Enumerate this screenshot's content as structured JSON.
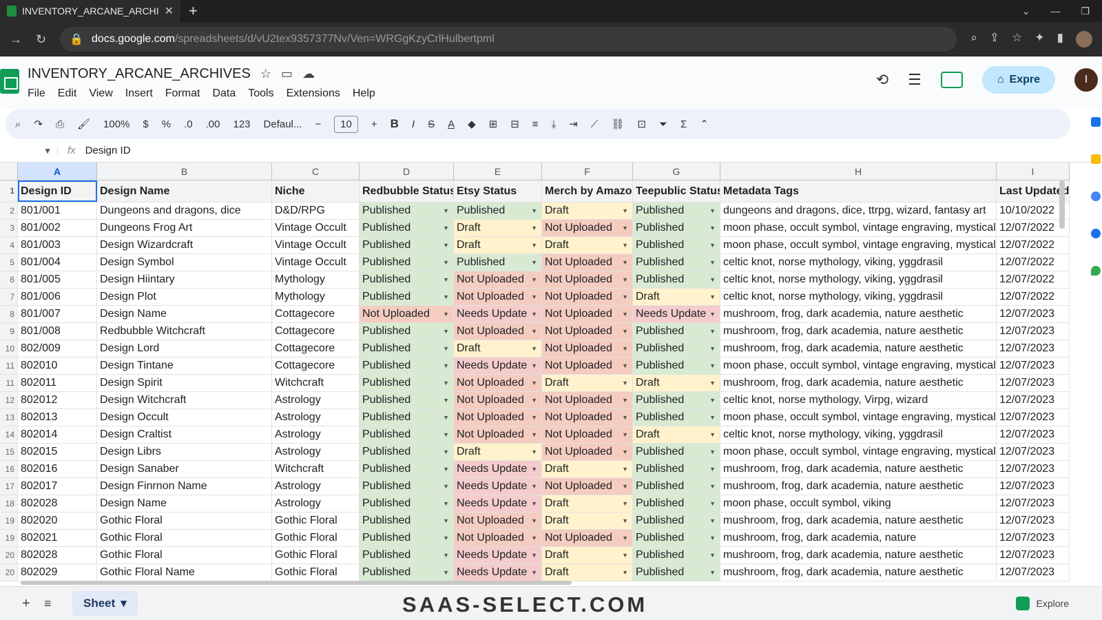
{
  "browser": {
    "tab_title": "INVENTORY_ARCANE_ARCHIVES",
    "url_host": "docs.google.com",
    "url_path": "/spreadsheets/d/vU2tex9357377Nv/Ven=WRGgKzyCrlHulbertpml"
  },
  "app": {
    "doc_title": "INVENTORY_ARCANE_ARCHIVES",
    "menus": [
      "File",
      "Edit",
      "View",
      "Insert",
      "Format",
      "Data",
      "Tools",
      "Extensions",
      "Help"
    ],
    "share_label": "Expre",
    "avatar_letter": "I"
  },
  "toolbar": {
    "zoom": "100%",
    "currency": "$",
    "percent": "%",
    "dec_decrease": ".0",
    "dec_increase": ".00",
    "number_format": "123",
    "font": "Defaul...",
    "font_size": "10",
    "bold": "B",
    "italic": "I",
    "strike": "S",
    "text_color": "A"
  },
  "formula_bar": {
    "value": "Design ID"
  },
  "columns": [
    "A",
    "B",
    "C",
    "D",
    "E",
    "F",
    "G",
    "H",
    "I"
  ],
  "header_row": {
    "row_num": "1",
    "cells": [
      "Design ID",
      "Design Name",
      "Niche",
      "Redbubble Status",
      "Etsy Status",
      "Merch by Amazo",
      "Teepublic Status",
      "Metadata Tags",
      "Last Updated"
    ]
  },
  "rows": [
    {
      "n": "2",
      "id": "801/001",
      "name": "Dungeons and dragons, dice",
      "niche": "D&D/RPG",
      "rb": "Published",
      "etsy": "Published",
      "merch": "Draft",
      "tee": "Published",
      "tags": "dungeons and dragons, dice, ttrpg, wizard, fantasy art",
      "date": "10/10/2022"
    },
    {
      "n": "3",
      "id": "801/002",
      "name": "Dungeons Frog Art",
      "niche": "Vintage Occult",
      "rb": "Published",
      "etsy": "Draft",
      "merch": "Not Uploaded",
      "tee": "Published",
      "tags": "moon phase, occult symbol, vintage engraving, mystical",
      "date": "12/07/2022"
    },
    {
      "n": "4",
      "id": "801/003",
      "name": "Design Wizardcraft",
      "niche": "Vintage Occult",
      "rb": "Published",
      "etsy": "Draft",
      "merch": "Draft",
      "tee": "Published",
      "tags": "moon phase, occult symbol, vintage engraving, mystical",
      "date": "12/07/2022"
    },
    {
      "n": "5",
      "id": "801/004",
      "name": "Design Symbol",
      "niche": "Vintage Occult",
      "rb": "Published",
      "etsy": "Published",
      "merch": "Not Uploaded",
      "tee": "Published",
      "tags": "celtic knot, norse mythology, viking, yggdrasil",
      "date": "12/07/2022"
    },
    {
      "n": "6",
      "id": "801/005",
      "name": "Design Hiintary",
      "niche": "Mythology",
      "rb": "Published",
      "etsy": "Not Uploaded",
      "merch": "Not Uploaded",
      "tee": "Published",
      "tags": "celtic knot, norse mythology, viking, yggdrasil",
      "date": "12/07/2022"
    },
    {
      "n": "7",
      "id": "801/006",
      "name": "Design Plot",
      "niche": "Mythology",
      "rb": "Published",
      "etsy": "Not Uploaded",
      "merch": "Not Uploaded",
      "tee": "Draft",
      "tags": "celtic knot, norse mythology, viking, yggdrasil",
      "date": "12/07/2022"
    },
    {
      "n": "8",
      "id": "801/007",
      "name": "Design Name",
      "niche": "Cottagecore",
      "rb": "Not Uploaded",
      "etsy": "Needs Update",
      "merch": "Not Uploaded",
      "tee": "Needs Update",
      "tags": "mushroom, frog, dark academia, nature aesthetic",
      "date": "12/07/2023"
    },
    {
      "n": "9",
      "id": "801/008",
      "name": "Redbubble Witchcraft",
      "niche": "Cottagecore",
      "rb": "Published",
      "etsy": "Not Uploaded",
      "merch": "Not Uploaded",
      "tee": "Published",
      "tags": "mushroom, frog, dark academia, nature aesthetic",
      "date": "12/07/2023"
    },
    {
      "n": "10",
      "id": "802/009",
      "name": "Design Lord",
      "niche": "Cottagecore",
      "rb": "Published",
      "etsy": "Draft",
      "merch": "Not Uploaded",
      "tee": "Published",
      "tags": "mushroom, frog, dark academia, nature aesthetic",
      "date": "12/07/2023"
    },
    {
      "n": "11",
      "id": "802010",
      "name": "Design Tintane",
      "niche": "Cottagecore",
      "rb": "Published",
      "etsy": "Needs Update",
      "merch": "Not Uploaded",
      "tee": "Published",
      "tags": "moon phase, occult symbol, vintage engraving, mystical",
      "date": "12/07/2023"
    },
    {
      "n": "11",
      "id": "802011",
      "name": "Design Spirit",
      "niche": "Witchcraft",
      "rb": "Published",
      "etsy": "Not Uploaded",
      "merch": "Draft",
      "tee": "Draft",
      "tags": "mushroom, frog, dark academia, nature aesthetic",
      "date": "12/07/2023"
    },
    {
      "n": "12",
      "id": "802012",
      "name": "Design Witchcraft",
      "niche": "Astrology",
      "rb": "Published",
      "etsy": "Not Uploaded",
      "merch": "Not Uploaded",
      "tee": "Published",
      "tags": "celtic knot, norse mythology, Virpg, wizard",
      "date": "12/07/2023"
    },
    {
      "n": "13",
      "id": "802013",
      "name": "Design Occult",
      "niche": "Astrology",
      "rb": "Published",
      "etsy": "Not Uploaded",
      "merch": "Not Uploaded",
      "tee": "Published",
      "tags": "moon phase, occult symbol, vintage engraving, mystical",
      "date": "12/07/2023"
    },
    {
      "n": "14",
      "id": "802014",
      "name": "Design Craltist",
      "niche": "Astrology",
      "rb": "Published",
      "etsy": "Not Uploaded",
      "merch": "Not Uploaded",
      "tee": "Draft",
      "tags": "celtic knot, norse mythology, viking, yggdrasil",
      "date": "12/07/2023"
    },
    {
      "n": "15",
      "id": "802015",
      "name": "Design Librs",
      "niche": "Astrology",
      "rb": "Published",
      "etsy": "Draft",
      "merch": "Not Uploaded",
      "tee": "Published",
      "tags": "moon phase, occult symbol, vintage engraving, mystical",
      "date": "12/07/2023"
    },
    {
      "n": "16",
      "id": "802016",
      "name": "Design Sanaber",
      "niche": "Witchcraft",
      "rb": "Published",
      "etsy": "Needs Update",
      "merch": "Draft",
      "tee": "Published",
      "tags": "mushroom, frog, dark academia, nature aesthetic",
      "date": "12/07/2023"
    },
    {
      "n": "17",
      "id": "802017",
      "name": "Design Finrnon Name",
      "niche": "Astrology",
      "rb": "Published",
      "etsy": "Needs Update",
      "merch": "Not Uploaded",
      "tee": "Published",
      "tags": "mushroom, frog, dark academia, nature aesthetic",
      "date": "12/07/2023"
    },
    {
      "n": "18",
      "id": "802028",
      "name": "Design Name",
      "niche": "Astrology",
      "rb": "Published",
      "etsy": "Needs Update",
      "merch": "Draft",
      "tee": "Published",
      "tags": "moon phase, occult symbol, viking",
      "date": "12/07/2023"
    },
    {
      "n": "19",
      "id": "802020",
      "name": "Gothic Floral",
      "niche": "Gothic Floral",
      "rb": "Published",
      "etsy": "Not Uploaded",
      "merch": "Draft",
      "tee": "Published",
      "tags": "mushroom, frog, dark academia, nature aesthetic",
      "date": "12/07/2023"
    },
    {
      "n": "19",
      "id": "802021",
      "name": "Gothic Floral",
      "niche": "Gothic Floral",
      "rb": "Published",
      "etsy": "Not Uploaded",
      "merch": "Not Uploaded",
      "tee": "Published",
      "tags": "mushroom, frog, dark academia, nature",
      "date": "12/07/2023"
    },
    {
      "n": "20",
      "id": "802028",
      "name": "Gothic Floral",
      "niche": "Gothic Floral",
      "rb": "Published",
      "etsy": "Needs Update",
      "merch": "Draft",
      "tee": "Published",
      "tags": "mushroom, frog, dark academia, nature aesthetic",
      "date": "12/07/2023"
    },
    {
      "n": "20",
      "id": "802029",
      "name": "Gothic Floral Name",
      "niche": "Gothic Floral",
      "rb": "Published",
      "etsy": "Needs Update",
      "merch": "Draft",
      "tee": "Published",
      "tags": "mushroom, frog, dark academia, nature aesthetic",
      "date": "12/07/2023"
    }
  ],
  "status_colors": {
    "Published": "#d9ead3",
    "Draft": "#fff2cc",
    "Not Uploaded": "#f4ccc0",
    "Needs Update": "#f4cccc"
  },
  "bottom": {
    "sheet_name": "Sheet",
    "watermark": "SAAS-SELECT.COM",
    "explore_label": "Explore"
  }
}
